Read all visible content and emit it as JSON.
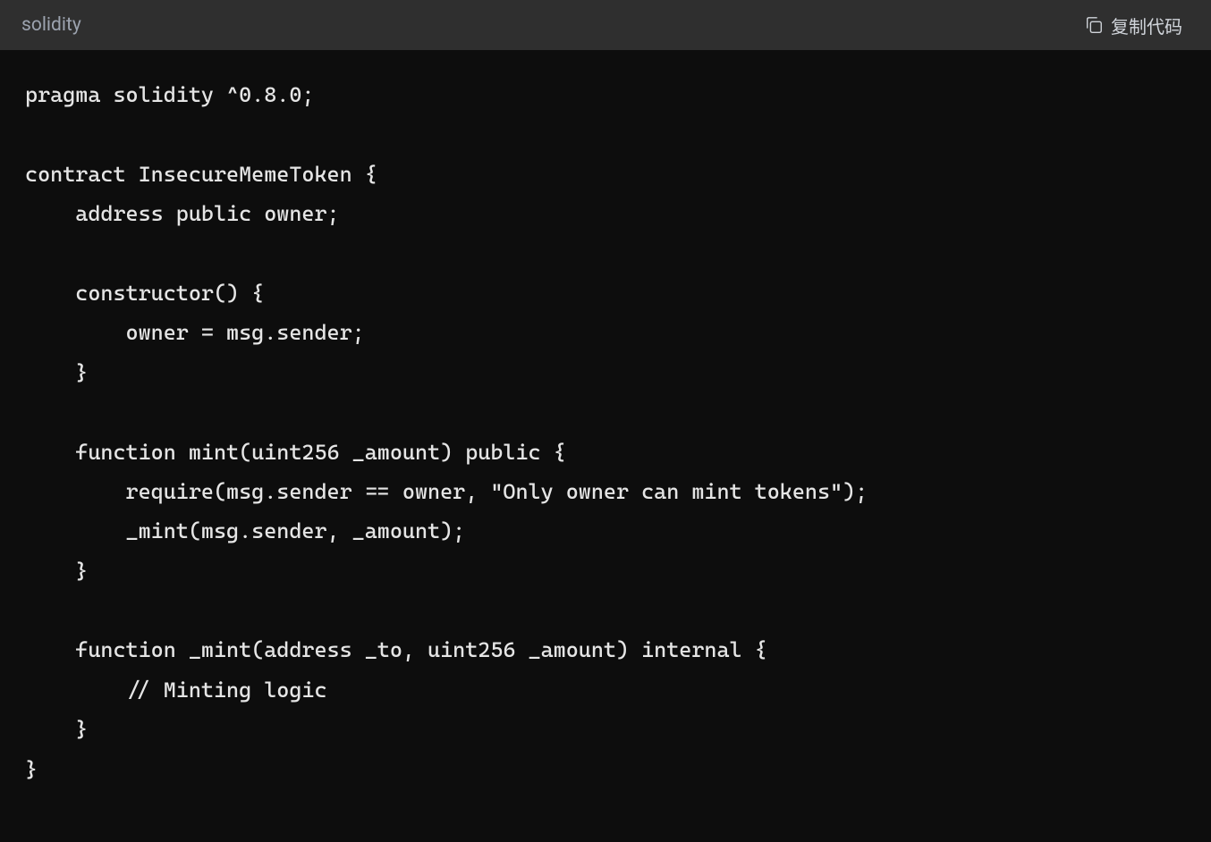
{
  "header": {
    "language": "solidity",
    "copy_label": "复制代码"
  },
  "code": {
    "lines": [
      "pragma solidity ^0.8.0;",
      "",
      "contract InsecureMemeToken {",
      "    address public owner;",
      "",
      "    constructor() {",
      "        owner = msg.sender;",
      "    }",
      "",
      "    function mint(uint256 _amount) public {",
      "        require(msg.sender == owner, \"Only owner can mint tokens\");",
      "        _mint(msg.sender, _amount);",
      "    }",
      "",
      "    function _mint(address _to, uint256 _amount) internal {",
      "        // Minting logic",
      "    }",
      "}"
    ]
  }
}
